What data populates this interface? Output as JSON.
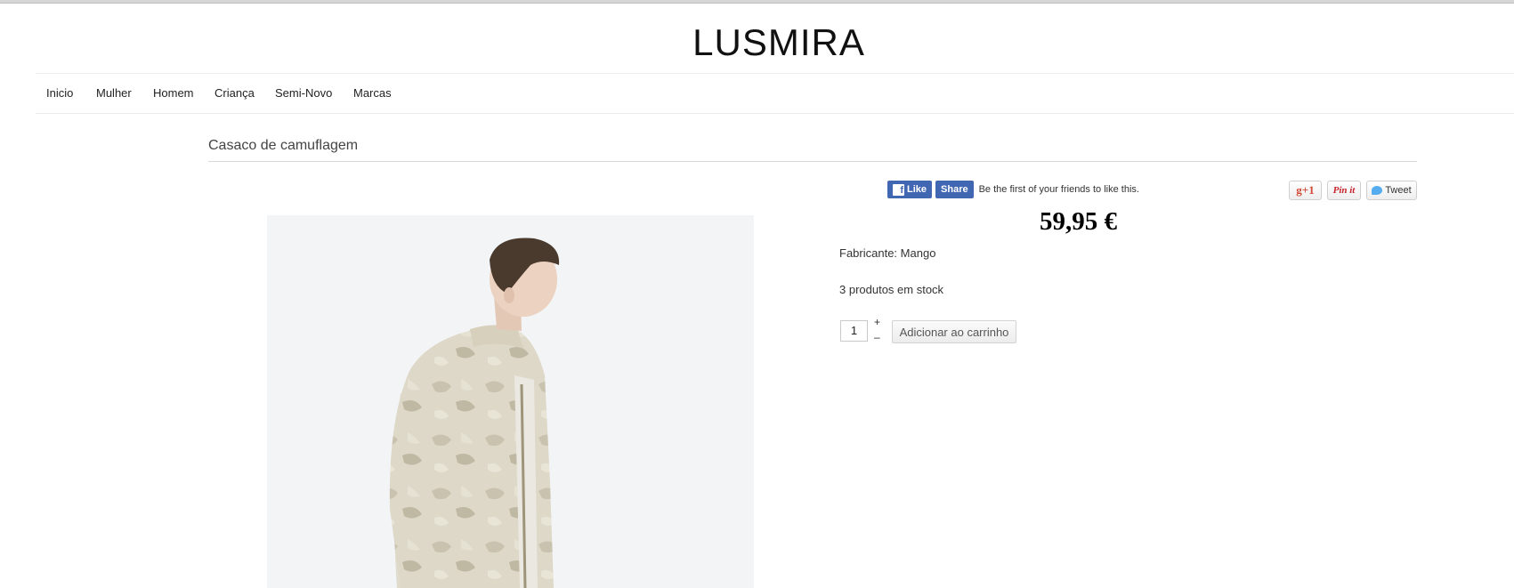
{
  "brand": {
    "logo": "LUSMIRA"
  },
  "nav": {
    "items": [
      "Inicio",
      "Mulher",
      "Homem",
      "Criança",
      "Semi-Novo",
      "Marcas"
    ]
  },
  "product": {
    "title": "Casaco de camuflagem",
    "price": "59,95 €",
    "manufacturer_label": "Fabricante:",
    "manufacturer": "Mango",
    "stock": "3 produtos em stock",
    "quantity": "1",
    "qty_plus": "+",
    "qty_minus": "–",
    "add_to_cart": "Adicionar ao carrinho"
  },
  "social": {
    "fb_like": "Like",
    "fb_share": "Share",
    "fb_text": "Be the first of your friends to like this.",
    "gplus": "g+1",
    "pinit": "Pin it",
    "tweet": "Tweet"
  }
}
